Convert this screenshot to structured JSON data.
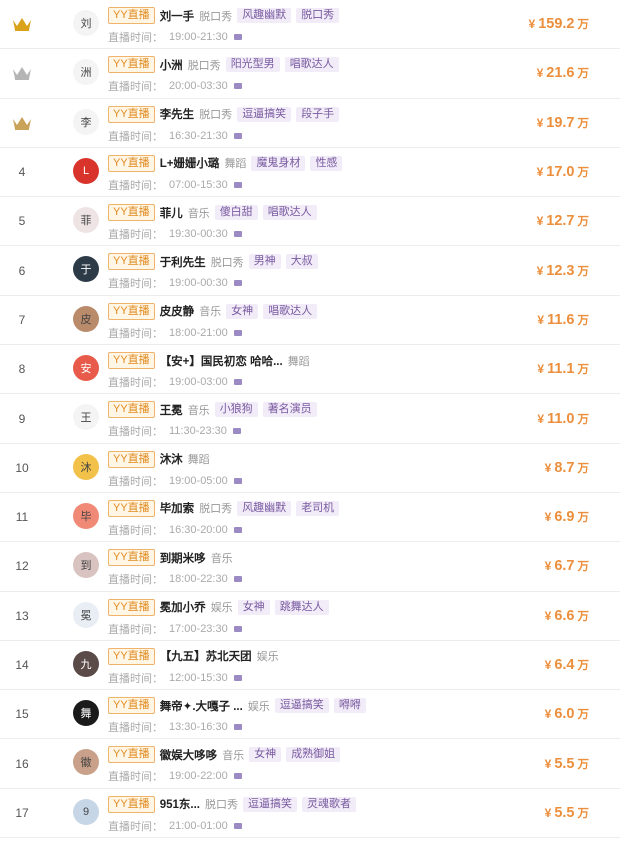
{
  "platform_badge": "YY直播",
  "time_label": "直播时间：",
  "currency": "¥",
  "unit": "万",
  "rows": [
    {
      "rank": "1",
      "crown": "gold-crown-icon",
      "avatar_text": "刘",
      "avatar_color": "#f4f4f4",
      "name": "刘一手",
      "category": "脱口秀",
      "tags": [
        "风趣幽默",
        "脱口秀"
      ],
      "time": "19:00-21:30",
      "amount": "159.2"
    },
    {
      "rank": "2",
      "crown": "silver-crown-icon",
      "avatar_text": "洲",
      "avatar_color": "#f4f4f4",
      "name": "小洲",
      "category": "脱口秀",
      "tags": [
        "阳光型男",
        "唱歌达人"
      ],
      "time": "20:00-03:30",
      "amount": "21.6"
    },
    {
      "rank": "3",
      "crown": "bronze-crown-icon",
      "avatar_text": "李",
      "avatar_color": "#f4f4f4",
      "name": "李先生",
      "category": "脱口秀",
      "tags": [
        "逗逼搞笑",
        "段子手"
      ],
      "time": "16:30-21:30",
      "amount": "19.7"
    },
    {
      "rank": "4",
      "crown": "",
      "avatar_text": "L",
      "avatar_color": "#d8342c",
      "name": "L+姗姗小璐",
      "category": "舞蹈",
      "tags": [
        "魔鬼身材",
        "性感"
      ],
      "time": "07:00-15:30",
      "amount": "17.0"
    },
    {
      "rank": "5",
      "crown": "",
      "avatar_text": "菲",
      "avatar_color": "#efe4e4",
      "name": "菲儿",
      "category": "音乐",
      "tags": [
        "傻白甜",
        "唱歌达人"
      ],
      "time": "19:30-00:30",
      "amount": "12.7"
    },
    {
      "rank": "6",
      "crown": "",
      "avatar_text": "于",
      "avatar_color": "#2d3a48",
      "name": "于利先生",
      "category": "脱口秀",
      "tags": [
        "男神",
        "大叔"
      ],
      "time": "19:00-00:30",
      "amount": "12.3"
    },
    {
      "rank": "7",
      "crown": "",
      "avatar_text": "皮",
      "avatar_color": "#b98b6b",
      "name": "皮皮静",
      "category": "音乐",
      "tags": [
        "女神",
        "唱歌达人"
      ],
      "time": "18:00-21:00",
      "amount": "11.6"
    },
    {
      "rank": "8",
      "crown": "",
      "avatar_text": "安",
      "avatar_color": "#e85b4a",
      "name": "【安+】国民初恋 哈哈...",
      "category": "舞蹈",
      "tags": [],
      "time": "19:00-03:00",
      "amount": "11.1"
    },
    {
      "rank": "9",
      "crown": "",
      "avatar_text": "王",
      "avatar_color": "#f4f4f4",
      "name": "王冕",
      "category": "音乐",
      "tags": [
        "小狼狗",
        "著名演员"
      ],
      "time": "11:30-23:30",
      "amount": "11.0"
    },
    {
      "rank": "10",
      "crown": "",
      "avatar_text": "沐",
      "avatar_color": "#f2c14a",
      "name": "沐沐",
      "category": "舞蹈",
      "tags": [],
      "time": "19:00-05:00",
      "amount": "8.7"
    },
    {
      "rank": "11",
      "crown": "",
      "avatar_text": "毕",
      "avatar_color": "#f08a76",
      "name": "毕加索",
      "category": "脱口秀",
      "tags": [
        "风趣幽默",
        "老司机"
      ],
      "time": "16:30-20:00",
      "amount": "6.9"
    },
    {
      "rank": "12",
      "crown": "",
      "avatar_text": "到",
      "avatar_color": "#d9c3c0",
      "name": "到期米哆",
      "category": "音乐",
      "tags": [],
      "time": "18:00-22:30",
      "amount": "6.7"
    },
    {
      "rank": "13",
      "crown": "",
      "avatar_text": "冕",
      "avatar_color": "#e8eef4",
      "name": "冕加小乔",
      "category": "娱乐",
      "tags": [
        "女神",
        "跳舞达人"
      ],
      "time": "17:00-23:30",
      "amount": "6.6"
    },
    {
      "rank": "14",
      "crown": "",
      "avatar_text": "九",
      "avatar_color": "#5a4a48",
      "name": "【九五】苏北天团",
      "category": "娱乐",
      "tags": [],
      "time": "12:00-15:30",
      "amount": "6.4"
    },
    {
      "rank": "15",
      "crown": "",
      "avatar_text": "舞",
      "avatar_color": "#1a1a1a",
      "name": "舞帝✦.大嘎子 ...",
      "category": "娱乐",
      "tags": [
        "逗逼搞笑",
        "嘚嘚"
      ],
      "time": "13:30-16:30",
      "amount": "6.0"
    },
    {
      "rank": "16",
      "crown": "",
      "avatar_text": "徽",
      "avatar_color": "#c9a089",
      "name": "徽娱大哆哆",
      "category": "音乐",
      "tags": [
        "女神",
        "成熟御姐"
      ],
      "time": "19:00-22:00",
      "amount": "5.5"
    },
    {
      "rank": "17",
      "crown": "",
      "avatar_text": "9",
      "avatar_color": "#c6d6e6",
      "name": "951东...",
      "category": "脱口秀",
      "tags": [
        "逗逼搞笑",
        "灵魂歌者"
      ],
      "time": "21:00-01:00",
      "amount": "5.5"
    }
  ]
}
